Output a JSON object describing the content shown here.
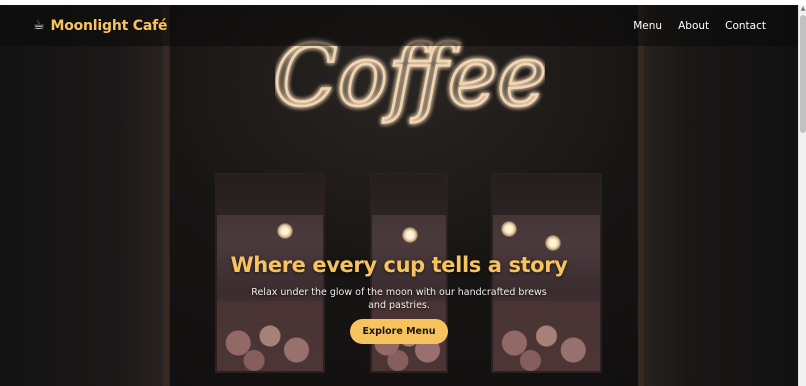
{
  "brand": {
    "icon": "coffee-cup-icon",
    "name": "Moonlight Café",
    "color": "#f7c35f"
  },
  "nav": {
    "items": [
      {
        "label": "Menu"
      },
      {
        "label": "About"
      },
      {
        "label": "Contact"
      }
    ]
  },
  "hero": {
    "background_sign": "Coffee",
    "title": "Where every cup tells a story",
    "subtitle": "Relax under the glow of the moon with our handcrafted brews and pastries.",
    "cta_label": "Explore Menu"
  },
  "colors": {
    "accent": "#f7c35f",
    "neon": "#f2d6b3"
  }
}
